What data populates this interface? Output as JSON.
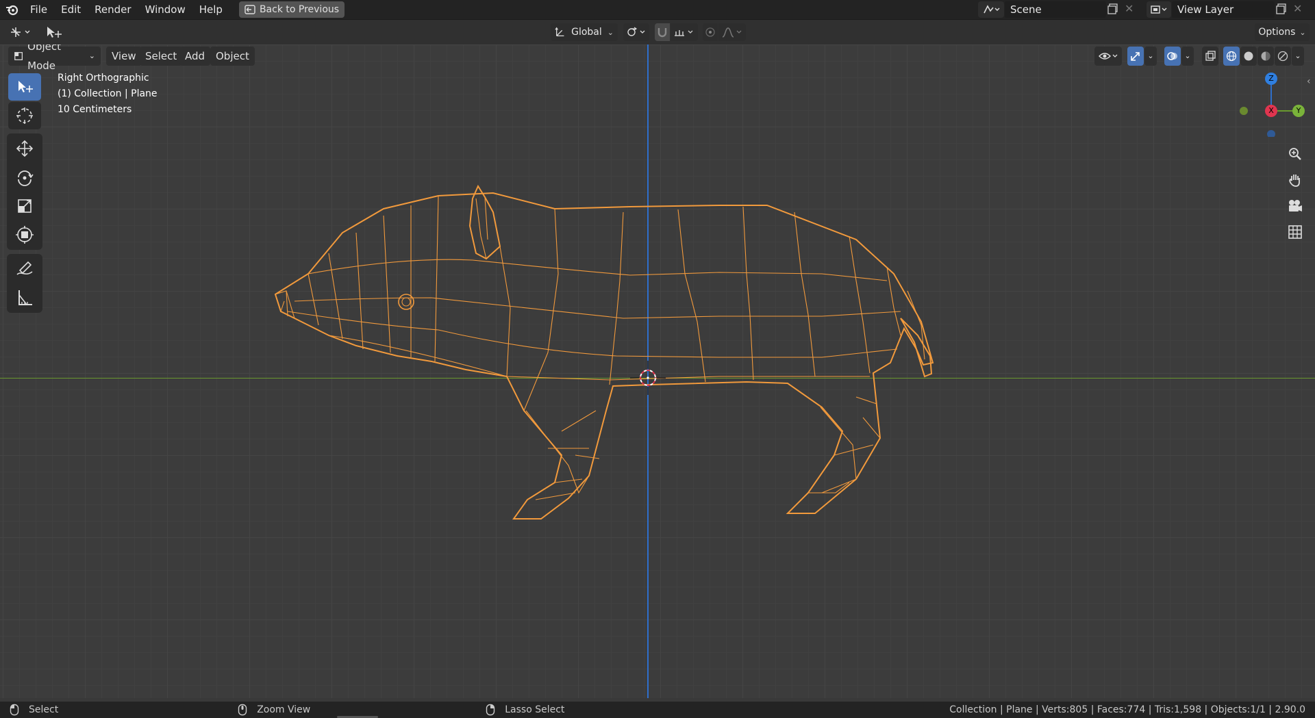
{
  "app": {
    "logo_icon": "blender-logo-icon"
  },
  "menu": {
    "file": "File",
    "edit": "Edit",
    "render": "Render",
    "window": "Window",
    "help": "Help"
  },
  "back_button": {
    "label": "Back to Previous",
    "icon": "back-icon"
  },
  "scene": {
    "label": "Scene"
  },
  "view_layer": {
    "label": "View Layer"
  },
  "toolbar": {
    "transform_orientation": "Global",
    "options_label": "Options"
  },
  "header": {
    "mode": "Object Mode",
    "view": "View",
    "select": "Select",
    "add": "Add",
    "object": "Object"
  },
  "viewport_info": {
    "view_name": "Right Orthographic",
    "collection": "(1) Collection | Plane",
    "scale": "10 Centimeters"
  },
  "gizmo": {
    "z": "Z",
    "x": "X",
    "y": "Y"
  },
  "statusbar": {
    "select": "Select",
    "zoom": "Zoom View",
    "lasso": "Lasso Select",
    "stats": "Collection | Plane | Verts:805 | Faces:774 | Tris:1,598 | Objects:1/1 | 2.90.0"
  },
  "colors": {
    "accent": "#4772b3",
    "wire": "#f29a3c",
    "axis_y": "#6a9a2f",
    "axis_z": "#2f6fcb"
  }
}
